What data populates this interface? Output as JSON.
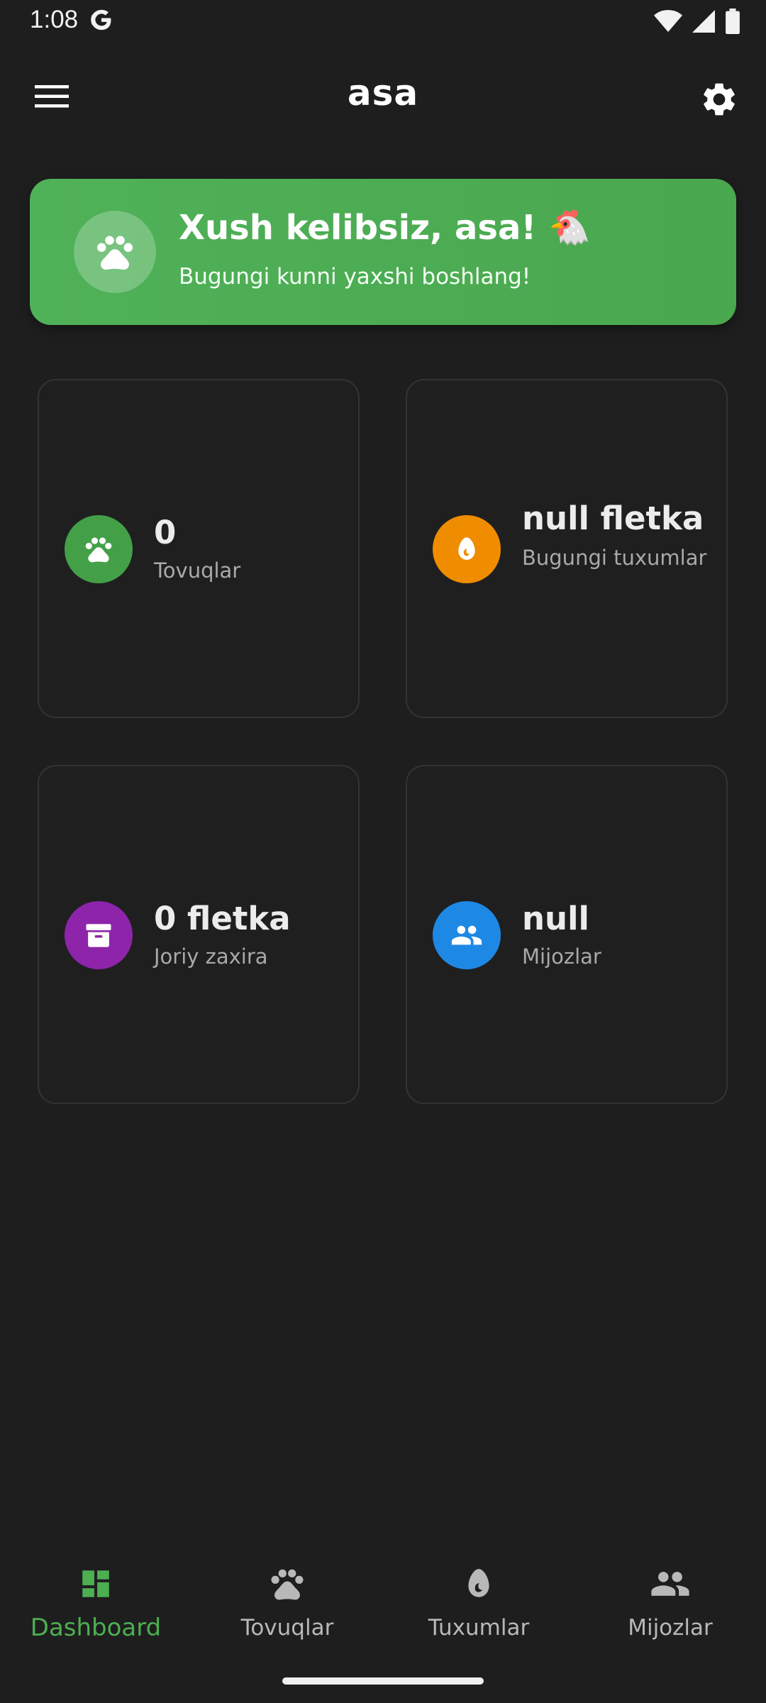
{
  "status_bar": {
    "time": "1:08",
    "google_icon": "google-g-icon",
    "icons": [
      "wifi-icon",
      "cell-signal-icon",
      "battery-icon"
    ]
  },
  "app_bar": {
    "title": "asa",
    "menu_icon": "hamburger-menu-icon",
    "settings_icon": "gear-icon"
  },
  "welcome": {
    "title": "Xush kelibsiz, asa! 🐔",
    "subtitle": "Bugungi kunni yaxshi boshlang!",
    "icon": "paw-icon",
    "color": "#4caf50"
  },
  "stats": [
    {
      "value": "0",
      "label": "Tovuqlar",
      "icon": "paw-icon",
      "color": "#43a047"
    },
    {
      "value": "null fletka",
      "label": "Bugungi tuxumlar",
      "icon": "egg-icon",
      "color": "#ef8c00"
    },
    {
      "value": "0 fletka",
      "label": "Joriy zaxira",
      "icon": "archive-box-icon",
      "color": "#8e24aa"
    },
    {
      "value": "null",
      "label": "Mijozlar",
      "icon": "people-icon",
      "color": "#1e88e5"
    }
  ],
  "bottom_nav": {
    "active_color": "#4caf50",
    "items": [
      {
        "label": "Dashboard",
        "icon": "dashboard-icon",
        "active": true
      },
      {
        "label": "Tovuqlar",
        "icon": "paw-icon",
        "active": false
      },
      {
        "label": "Tuxumlar",
        "icon": "egg-icon",
        "active": false
      },
      {
        "label": "Mijozlar",
        "icon": "people-icon",
        "active": false
      }
    ]
  }
}
